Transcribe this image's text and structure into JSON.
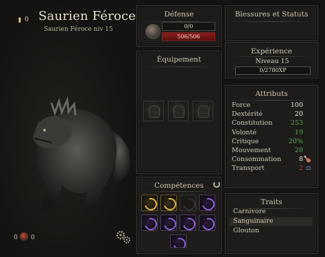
{
  "header": {
    "level_up_points": "0",
    "name": "Saurien Féroce",
    "subtitle": "Saurien Féroce niv 15"
  },
  "bottom_left": {
    "left_count": "0",
    "right_count": "0"
  },
  "defense": {
    "title": "Défense",
    "armor": "0/0",
    "health": "506/506"
  },
  "wounds": {
    "title": "Blessures et Statuts"
  },
  "equipment": {
    "title": "Équipement",
    "slots": [
      "armor-slot-1",
      "armor-slot-2",
      "armor-slot-3"
    ]
  },
  "experience": {
    "title": "Expérience",
    "level": "Niveau 15",
    "xp": "0/2780XP"
  },
  "attributes": {
    "title": "Attributs",
    "rows": [
      {
        "label": "Force",
        "value": "100",
        "color": "#ece6d8"
      },
      {
        "label": "Dextérité",
        "value": "20",
        "color": "#ece6d8"
      },
      {
        "label": "Constitution",
        "value": "253",
        "color": "#4fae4a"
      },
      {
        "label": "Volonté",
        "value": "19",
        "color": "#4fae4a"
      },
      {
        "label": "Critique",
        "value": "20%",
        "color": "#4fae4a"
      },
      {
        "label": "Mouvement",
        "value": "20",
        "color": "#4fae4a"
      },
      {
        "label": "Consommation",
        "value": "8",
        "color": "#ece6d8",
        "icon": "drumstick-icon"
      },
      {
        "label": "Transport",
        "value": "2",
        "color": "#c8443a",
        "icon": "weight-icon"
      }
    ]
  },
  "skills": {
    "title": "Compétences"
  },
  "traits": {
    "title": "Traits",
    "items": [
      "Carnivore",
      "Sanguinaire",
      "Glouton"
    ]
  },
  "colors": {
    "background": "#151412",
    "panel": "#1d1c1a",
    "health_bar": "#8c1c1c",
    "positive": "#4fae4a",
    "negative": "#c8443a"
  }
}
